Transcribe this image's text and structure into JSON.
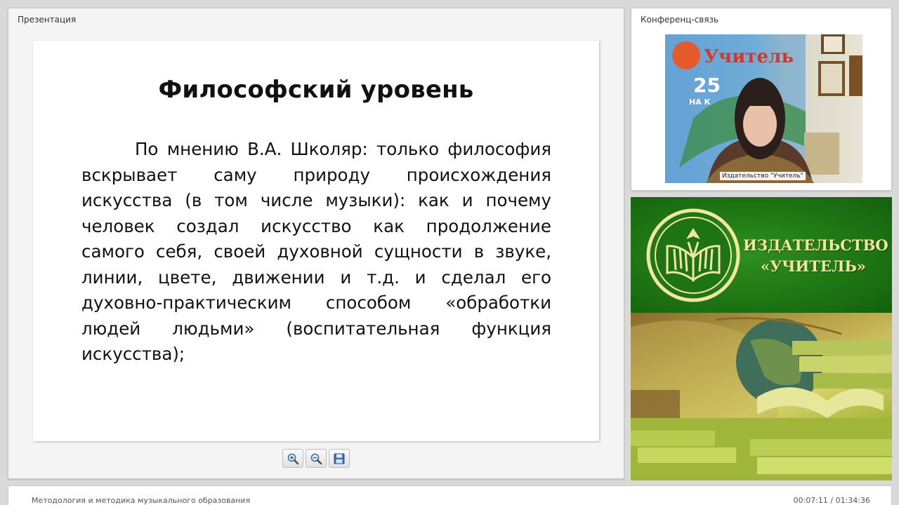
{
  "presentation": {
    "panel_title": "Презентация",
    "slide": {
      "title": "Философский уровень",
      "body": "По мнению В.А. Школяр: только философия вскрывает саму природу происхождения искусства (в том числе музыки): как и почему человек создал искусство как продолжение самого себя, своей духовной сущности в звуке, линии, цвете, движении и т.д. и сделал его духовно-практическим способом «обработки людей людьми» (воспитательная функция искусства);"
    },
    "toolbar": {
      "zoom_in_icon": "zoom-in-icon",
      "zoom_out_icon": "zoom-out-icon",
      "save_icon": "save-icon"
    }
  },
  "conference": {
    "panel_title": "Конференц-связь",
    "video_caption": "Издательство \"Учитель\"",
    "backdrop_logo_text": "Учитель",
    "backdrop_number": "25",
    "backdrop_sub": "НА К"
  },
  "banner": {
    "line1": "ИЗДАТЕЛЬСТВО",
    "line2": "«УЧИТЕЛЬ»",
    "colors": {
      "green": "#1f7614",
      "gold": "#f3e6a0"
    }
  },
  "footer": {
    "course_title": "Методология и методика музыкального образования",
    "time": "00:07:11 / 01:34:36"
  }
}
